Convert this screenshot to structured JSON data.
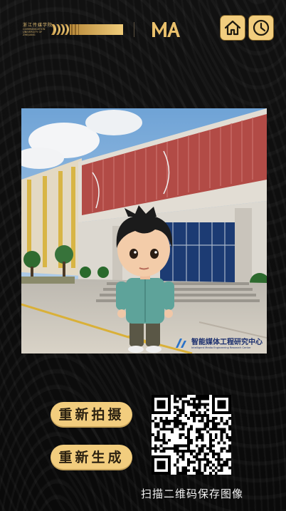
{
  "header": {
    "university_logo": {
      "name_cn": "浙江传媒学院",
      "name_en": "COMMUNICATION UNIVERSITY OF ZHEJIANG"
    },
    "brand_logo_text": "MA",
    "home_icon": "home-icon",
    "history_icon": "clock-icon"
  },
  "photo": {
    "watermark_cn": "智能媒体工程研究中心",
    "watermark_en": "Intelligent Media Engineering Research Center"
  },
  "actions": {
    "retake_label": "重新拍摄",
    "regenerate_label": "重新生成"
  },
  "qr": {
    "caption": "扫描二维码保存图像"
  },
  "colors": {
    "accent_gold": "#f2cd7e",
    "background": "#0d0d0d"
  }
}
